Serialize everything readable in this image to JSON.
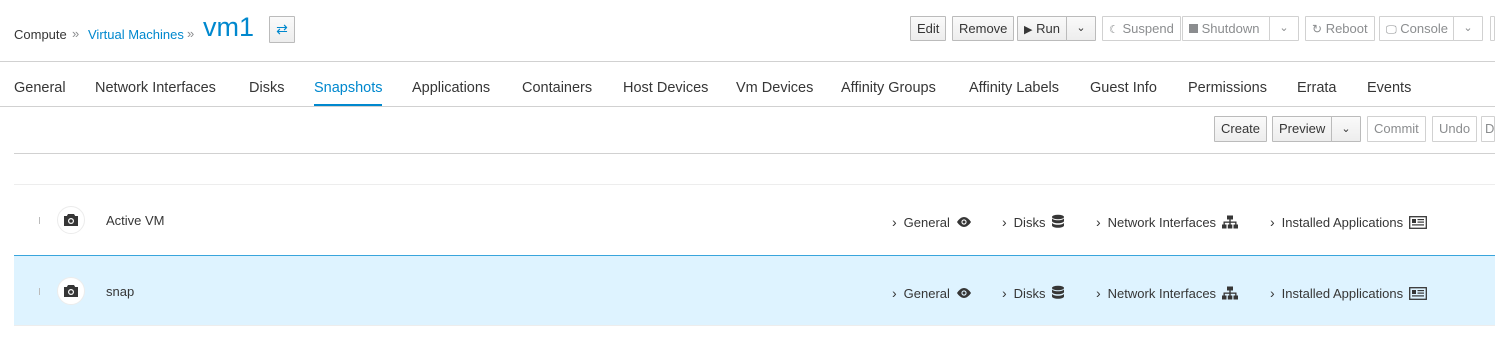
{
  "breadcrumb": {
    "root": "Compute",
    "section": "Virtual Machines",
    "separator": "»",
    "title": "vm1"
  },
  "toolbar": {
    "edit": "Edit",
    "remove": "Remove",
    "run": "Run",
    "suspend": "Suspend",
    "shutdown": "Shutdown",
    "reboot": "Reboot",
    "console": "Console"
  },
  "tabs": [
    {
      "label": "General"
    },
    {
      "label": "Network Interfaces"
    },
    {
      "label": "Disks"
    },
    {
      "label": "Snapshots",
      "active": true
    },
    {
      "label": "Applications"
    },
    {
      "label": "Containers"
    },
    {
      "label": "Host Devices"
    },
    {
      "label": "Vm Devices"
    },
    {
      "label": "Affinity Groups"
    },
    {
      "label": "Affinity Labels"
    },
    {
      "label": "Guest Info"
    },
    {
      "label": "Permissions"
    },
    {
      "label": "Errata"
    },
    {
      "label": "Events"
    }
  ],
  "snapshot_toolbar": {
    "create": "Create",
    "preview": "Preview",
    "commit": "Commit",
    "undo": "Undo",
    "delete_partial": "D"
  },
  "snapshots": [
    {
      "name": "Active VM",
      "selected": false,
      "links": {
        "general": "General",
        "disks": "Disks",
        "nics": "Network Interfaces",
        "apps": "Installed Applications"
      }
    },
    {
      "name": "snap",
      "selected": true,
      "links": {
        "general": "General",
        "disks": "Disks",
        "nics": "Network Interfaces",
        "apps": "Installed Applications"
      }
    }
  ],
  "colors": {
    "accent": "#0088ce",
    "selected_row": "#def3ff"
  }
}
